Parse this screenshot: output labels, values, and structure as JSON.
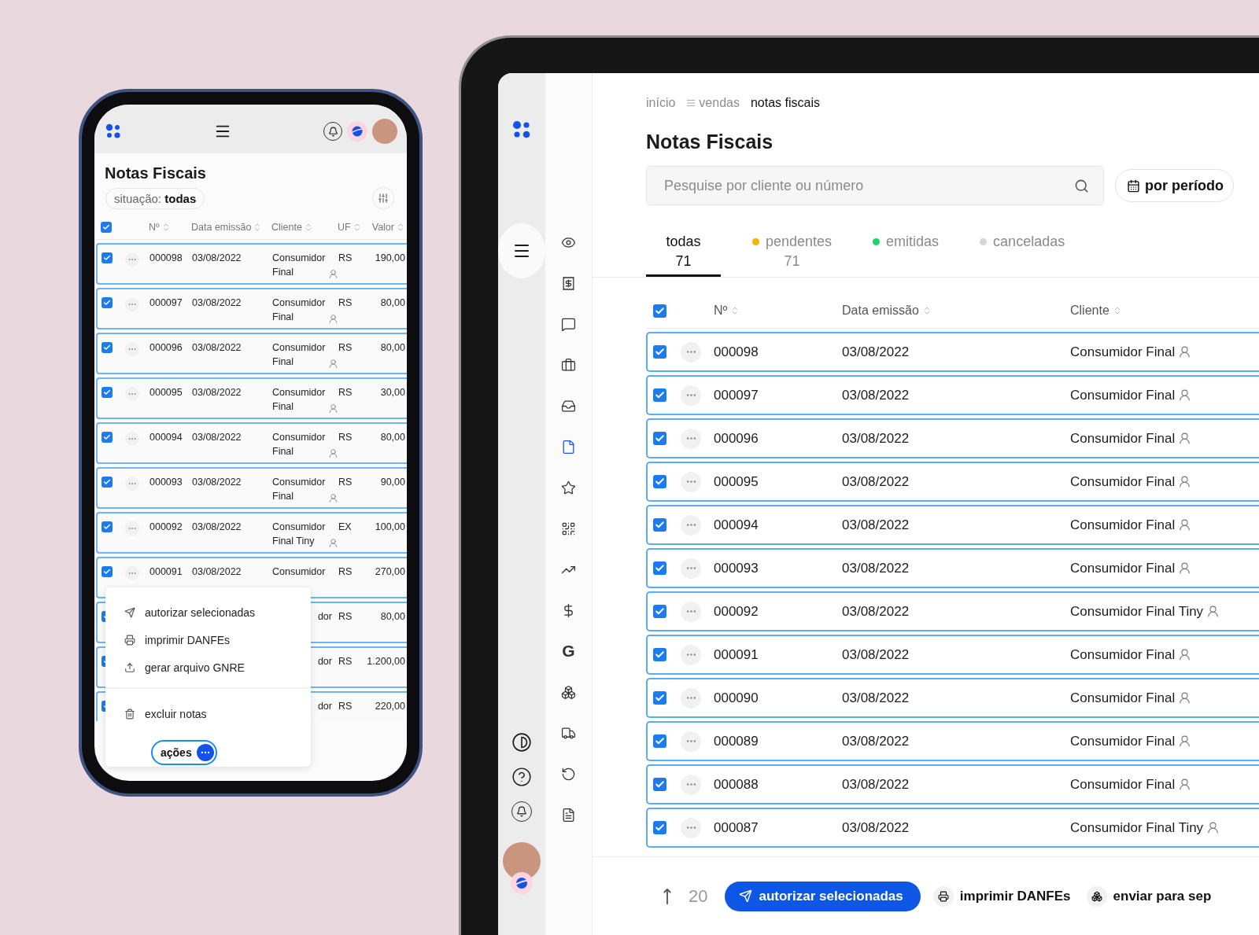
{
  "phone": {
    "title": "Notas Fiscais",
    "filter_chip": "situação: **todas**",
    "header_checked": true,
    "columns": [
      "Nº",
      "Data emissão",
      "Cliente",
      "UF",
      "Valor"
    ],
    "rows": [
      {
        "checked": true,
        "number": "000098",
        "date": "03/08/2022",
        "client": "Consumidor Final",
        "client_icon": true,
        "uf": "RS",
        "value": "190,00"
      },
      {
        "checked": true,
        "number": "000097",
        "date": "03/08/2022",
        "client": "Consumidor Final",
        "client_icon": true,
        "uf": "RS",
        "value": "80,00"
      },
      {
        "checked": true,
        "number": "000096",
        "date": "03/08/2022",
        "client": "Consumidor Final",
        "client_icon": true,
        "uf": "RS",
        "value": "80,00"
      },
      {
        "checked": true,
        "number": "000095",
        "date": "03/08/2022",
        "client": "Consumidor Final",
        "client_icon": true,
        "uf": "RS",
        "value": "30,00"
      },
      {
        "checked": true,
        "number": "000094",
        "date": "03/08/2022",
        "client": "Consumidor Final",
        "client_icon": true,
        "uf": "RS",
        "value": "80,00"
      },
      {
        "checked": true,
        "number": "000093",
        "date": "03/08/2022",
        "client": "Consumidor Final",
        "client_icon": true,
        "uf": "RS",
        "value": "90,00"
      },
      {
        "checked": true,
        "number": "000092",
        "date": "03/08/2022",
        "client": "Consumidor Final Tiny",
        "client_icon": true,
        "uf": "EX",
        "value": "100,00"
      },
      {
        "checked": true,
        "number": "000091",
        "date": "03/08/2022",
        "client": "Consumidor",
        "client_icon": false,
        "uf": "RS",
        "value": "270,00"
      }
    ],
    "covered_rows": [
      {
        "checked": true,
        "client": "dor",
        "uf": "RS",
        "value": "80,00"
      },
      {
        "checked": true,
        "client": "dor",
        "uf": "RS",
        "value": "1.200,00"
      },
      {
        "checked": true,
        "client": "dor",
        "uf": "RS",
        "value": "220,00"
      }
    ],
    "actions_menu": {
      "groups": [
        [
          {
            "kind": "send",
            "label": "autorizar selecionadas"
          },
          {
            "kind": "print",
            "label": "imprimir DANFEs"
          },
          {
            "kind": "upload",
            "label": "gerar arquivo GNRE"
          }
        ],
        [
          {
            "kind": "trash",
            "label": "excluir notas"
          }
        ]
      ],
      "button": "ações"
    }
  },
  "tablet": {
    "rail": [
      {
        "kind": "eye",
        "selected": false
      },
      {
        "kind": "receipt",
        "selected": false
      },
      {
        "kind": "message",
        "selected": false
      },
      {
        "kind": "briefcase",
        "selected": false
      },
      {
        "kind": "inbox",
        "selected": false
      },
      {
        "kind": "file",
        "selected": true
      },
      {
        "kind": "star",
        "selected": false
      },
      {
        "kind": "qr",
        "selected": false
      },
      {
        "kind": "chart",
        "selected": false
      },
      {
        "kind": "dollar",
        "selected": false
      },
      {
        "kind": "letter",
        "label": "G",
        "selected": false
      },
      {
        "kind": "boxes",
        "selected": false
      },
      {
        "kind": "truck",
        "selected": false
      },
      {
        "kind": "undo",
        "selected": false
      },
      {
        "kind": "report",
        "selected": false
      }
    ],
    "breadcrumb": [
      {
        "label": "início",
        "current": false,
        "menu": false
      },
      {
        "label": "vendas",
        "current": false,
        "menu": true
      },
      {
        "label": "notas fiscais",
        "current": true,
        "menu": false
      }
    ],
    "title": "Notas Fiscais",
    "search": {
      "placeholder": "Pesquise por cliente ou número"
    },
    "period_button": "por período",
    "tabs": [
      {
        "label": "todas",
        "count": "71",
        "selected": true
      },
      {
        "label": "pendentes",
        "count": "71",
        "color": "#f5b400",
        "selected": false
      },
      {
        "label": "emitidas",
        "color": "#1ed36b",
        "selected": false
      },
      {
        "label": "canceladas",
        "color": "#d6d6d6",
        "selected": false
      }
    ],
    "header_checked": true,
    "columns": [
      "Nº",
      "Data emissão",
      "Cliente"
    ],
    "rows": [
      {
        "checked": true,
        "number": "000098",
        "date": "03/08/2022",
        "client": "Consumidor Final"
      },
      {
        "checked": true,
        "number": "000097",
        "date": "03/08/2022",
        "client": "Consumidor Final"
      },
      {
        "checked": true,
        "number": "000096",
        "date": "03/08/2022",
        "client": "Consumidor Final"
      },
      {
        "checked": true,
        "number": "000095",
        "date": "03/08/2022",
        "client": "Consumidor Final"
      },
      {
        "checked": true,
        "number": "000094",
        "date": "03/08/2022",
        "client": "Consumidor Final"
      },
      {
        "checked": true,
        "number": "000093",
        "date": "03/08/2022",
        "client": "Consumidor Final"
      },
      {
        "checked": true,
        "number": "000092",
        "date": "03/08/2022",
        "client": "Consumidor Final Tiny"
      },
      {
        "checked": true,
        "number": "000091",
        "date": "03/08/2022",
        "client": "Consumidor Final"
      },
      {
        "checked": true,
        "number": "000090",
        "date": "03/08/2022",
        "client": "Consumidor Final"
      },
      {
        "checked": true,
        "number": "000089",
        "date": "03/08/2022",
        "client": "Consumidor Final"
      },
      {
        "checked": true,
        "number": "000088",
        "date": "03/08/2022",
        "client": "Consumidor Final"
      },
      {
        "checked": true,
        "number": "000087",
        "date": "03/08/2022",
        "client": "Consumidor Final Tiny"
      }
    ],
    "footer": {
      "count": "20",
      "buttons": [
        {
          "kind": "primary",
          "label": "autorizar selecionadas"
        },
        {
          "kind": "plain",
          "label": "imprimir DANFEs"
        },
        {
          "kind": "plain",
          "label": "enviar para sep"
        }
      ]
    }
  }
}
